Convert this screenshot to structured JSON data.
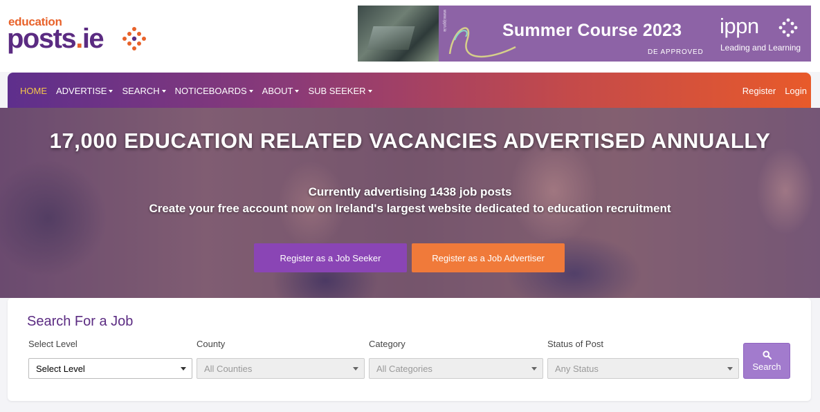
{
  "logo": {
    "small": "education",
    "big_main": "posts",
    "big_dot": ".",
    "big_tld": "ie"
  },
  "banner": {
    "title": "Summer Course 2023",
    "sub": "DE APPROVED",
    "org": "ippn",
    "tagline": "Leading and Learning",
    "vertical_text": "www.ippn.ie"
  },
  "nav": {
    "left": [
      {
        "label": "HOME",
        "active": true,
        "dropdown": false
      },
      {
        "label": "ADVERTISE",
        "active": false,
        "dropdown": true
      },
      {
        "label": "SEARCH",
        "active": false,
        "dropdown": true
      },
      {
        "label": "NOTICEBOARDS",
        "active": false,
        "dropdown": true
      },
      {
        "label": "ABOUT",
        "active": false,
        "dropdown": true
      },
      {
        "label": "SUB SEEKER",
        "active": false,
        "dropdown": true
      }
    ],
    "right": [
      {
        "label": "Register"
      },
      {
        "label": "Login"
      }
    ]
  },
  "hero": {
    "headline": "17,000 EDUCATION RELATED VACANCIES ADVERTISED ANNUALLY",
    "line1": "Currently advertising 1438 job posts",
    "line2": "Create your free account now on Ireland's largest website dedicated to education recruitment",
    "btn_seeker": "Register as a Job Seeker",
    "btn_advertiser": "Register as a Job Advertiser"
  },
  "search": {
    "title": "Search For a Job",
    "fields": [
      {
        "label": "Select Level",
        "value": "Select Level",
        "disabled": false
      },
      {
        "label": "County",
        "value": "All Counties",
        "disabled": true
      },
      {
        "label": "Category",
        "value": "All Categories",
        "disabled": true
      },
      {
        "label": "Status of Post",
        "value": "Any Status",
        "disabled": true
      }
    ],
    "button": "Search"
  },
  "colors": {
    "brand_purple": "#5b2b82",
    "brand_orange": "#e8622a",
    "active_nav": "#f5c84a"
  }
}
